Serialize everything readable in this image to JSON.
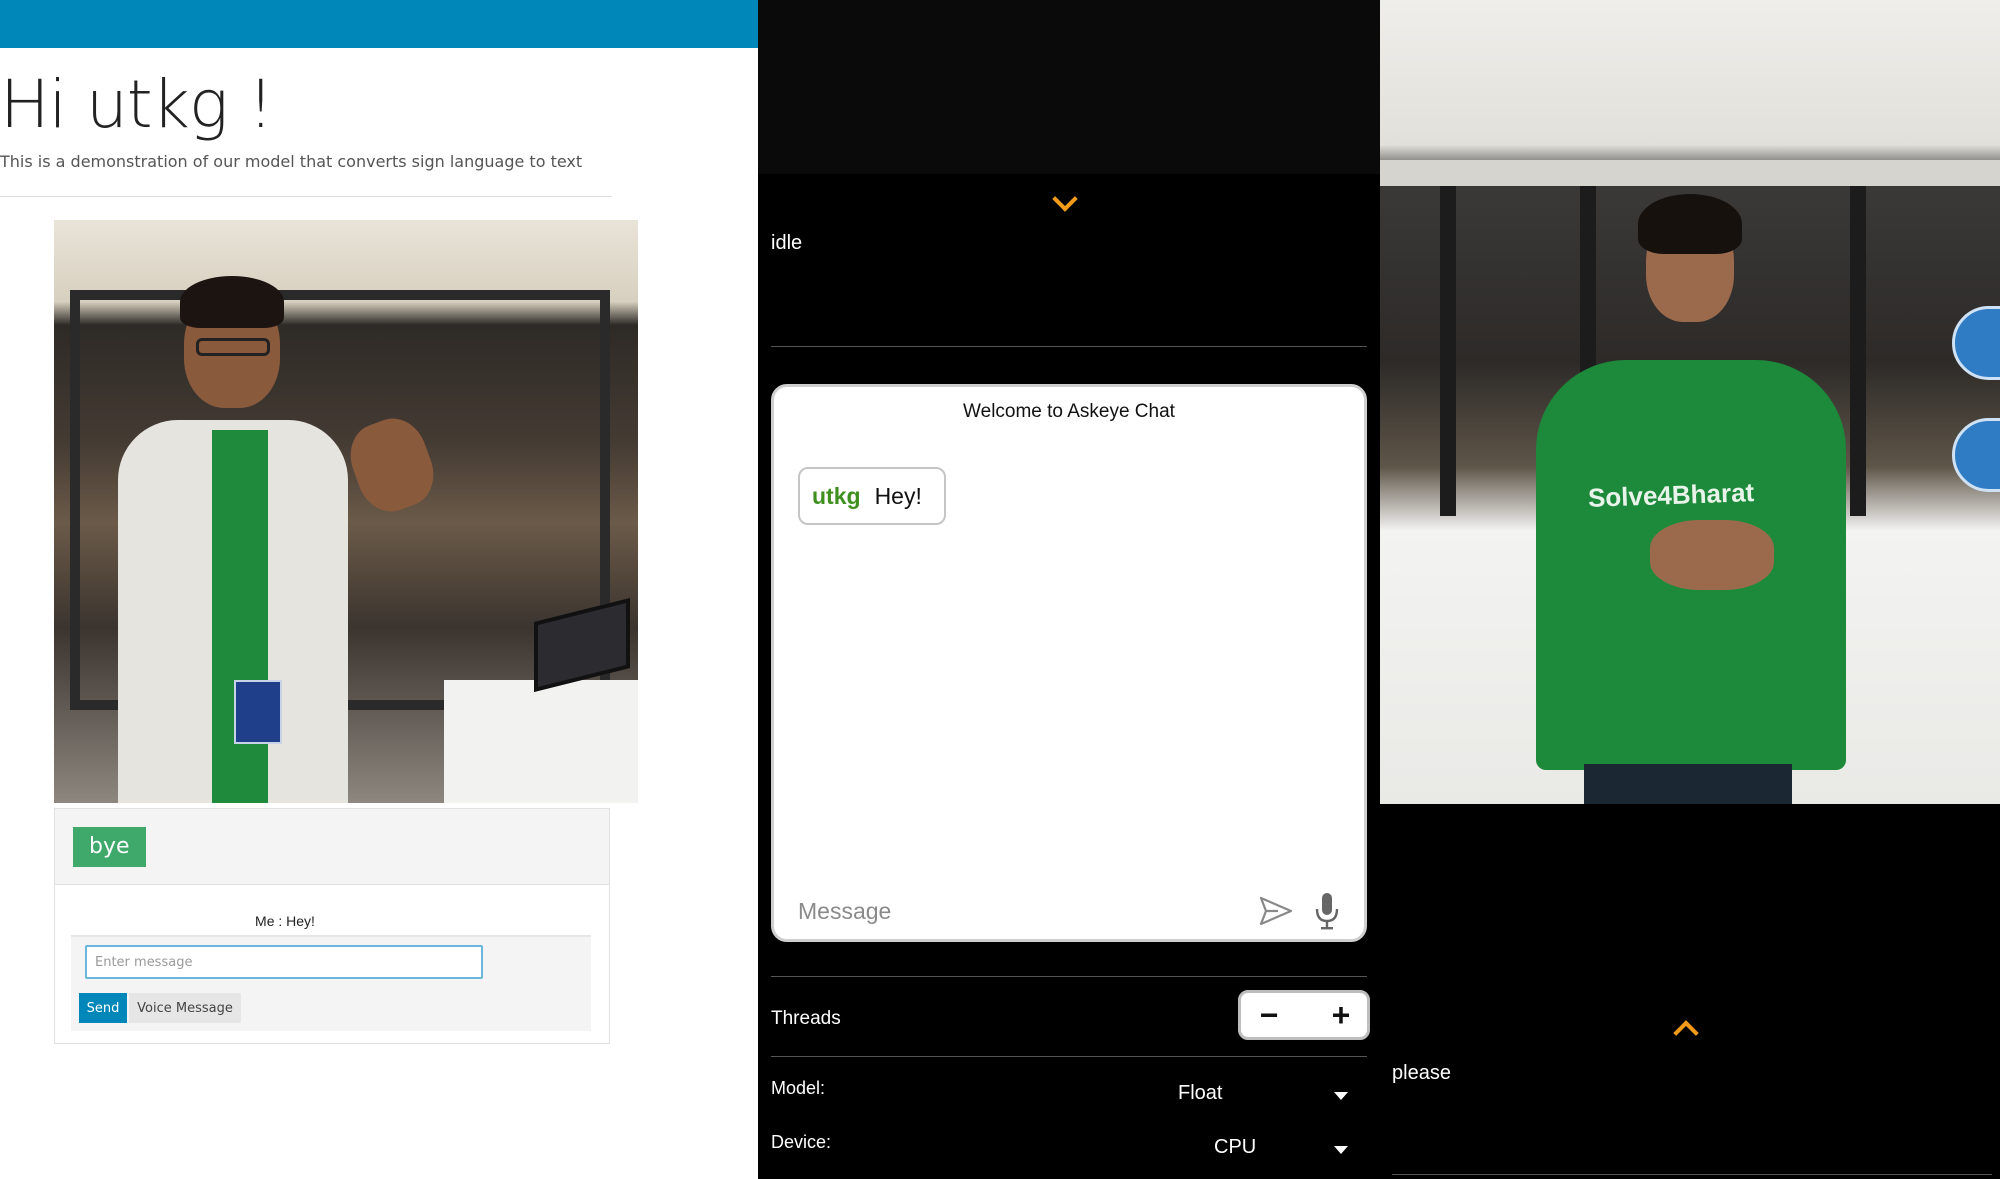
{
  "web_demo": {
    "greeting": "Hi utkg !",
    "subtitle": "This is a demonstration of our model that converts sign language to text",
    "prediction": "bye",
    "chat_log": "Me : Hey!",
    "message_placeholder": "Enter message",
    "send_label": "Send",
    "voice_label": "Voice Message",
    "accent_color": "#0087b9",
    "prediction_color": "#3fa96b"
  },
  "android_chat": {
    "status": "idle",
    "chat_title": "Welcome to Askeye Chat",
    "message": {
      "user": "utkg",
      "text": "Hey!"
    },
    "input_placeholder": "Message",
    "send_icon": "send-icon",
    "mic_icon": "microphone-icon",
    "threads_label": "Threads",
    "threads_minus": "−",
    "threads_plus": "+",
    "model_label": "Model:",
    "model_value": "Float",
    "device_label": "Device:",
    "device_value": "CPU",
    "chevron_color": "#f29a1a",
    "username_color": "#3f8f1e"
  },
  "android_camera": {
    "tshirt_text": "Solve4Bharat",
    "status": "please"
  }
}
